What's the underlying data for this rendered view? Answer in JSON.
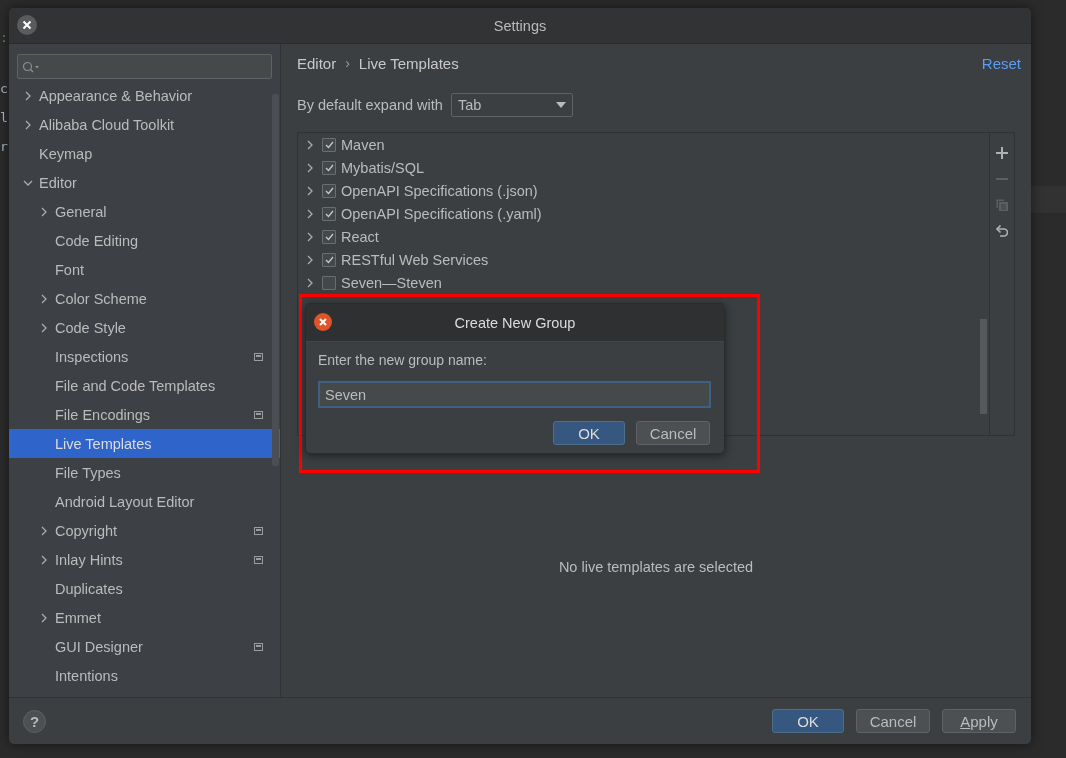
{
  "window": {
    "title": "Settings"
  },
  "background_editor": {
    "fragments": [
      ":",
      "c",
      "l",
      "r"
    ]
  },
  "sidebar": {
    "items": [
      {
        "label": "Appearance & Behavior",
        "expanded": false,
        "selected": false,
        "project_level": false
      },
      {
        "label": "Alibaba Cloud Toolkit",
        "expanded": false,
        "selected": false,
        "project_level": false
      },
      {
        "label": "Keymap",
        "selected": false,
        "project_level": false
      },
      {
        "label": "Editor",
        "expanded": true,
        "selected": false,
        "project_level": false,
        "children": [
          {
            "label": "General",
            "expanded": false,
            "selected": false,
            "project_level": false
          },
          {
            "label": "Code Editing",
            "selected": false,
            "project_level": false
          },
          {
            "label": "Font",
            "selected": false,
            "project_level": false
          },
          {
            "label": "Color Scheme",
            "expanded": false,
            "selected": false,
            "project_level": false
          },
          {
            "label": "Code Style",
            "expanded": false,
            "selected": false,
            "project_level": false
          },
          {
            "label": "Inspections",
            "selected": false,
            "project_level": true
          },
          {
            "label": "File and Code Templates",
            "selected": false,
            "project_level": false
          },
          {
            "label": "File Encodings",
            "selected": false,
            "project_level": true
          },
          {
            "label": "Live Templates",
            "selected": true,
            "project_level": false
          },
          {
            "label": "File Types",
            "selected": false,
            "project_level": false
          },
          {
            "label": "Android Layout Editor",
            "selected": false,
            "project_level": false
          },
          {
            "label": "Copyright",
            "expanded": false,
            "selected": false,
            "project_level": true
          },
          {
            "label": "Inlay Hints",
            "expanded": false,
            "selected": false,
            "project_level": true
          },
          {
            "label": "Duplicates",
            "selected": false,
            "project_level": false
          },
          {
            "label": "Emmet",
            "expanded": false,
            "selected": false,
            "project_level": false
          },
          {
            "label": "GUI Designer",
            "selected": false,
            "project_level": true
          },
          {
            "label": "Intentions",
            "selected": false,
            "project_level": false
          }
        ]
      }
    ]
  },
  "breadcrumb": {
    "items": [
      "Editor",
      "Live Templates"
    ],
    "separator": "›"
  },
  "reset_link": "Reset",
  "expand_setting": {
    "label": "By default expand with",
    "value": "Tab"
  },
  "template_groups": [
    {
      "label": "Maven",
      "expanded": false,
      "checked": true
    },
    {
      "label": "Mybatis/SQL",
      "expanded": false,
      "checked": true
    },
    {
      "label": "OpenAPI Specifications (.json)",
      "expanded": false,
      "checked": true
    },
    {
      "label": "OpenAPI Specifications (.yaml)",
      "expanded": false,
      "checked": true
    },
    {
      "label": "React",
      "expanded": false,
      "checked": true
    },
    {
      "label": "RESTful Web Services",
      "expanded": false,
      "checked": true
    },
    {
      "label": "Seven—Steven",
      "expanded": false,
      "checked": false
    }
  ],
  "list_toolbar": [
    {
      "kind": "add",
      "disabled": false
    },
    {
      "kind": "remove",
      "disabled": true
    },
    {
      "kind": "copy",
      "disabled": true
    },
    {
      "kind": "restore",
      "disabled": false
    }
  ],
  "empty_message": "No live templates are selected",
  "footer": {
    "help": "?",
    "buttons": [
      {
        "label": "OK",
        "primary": true
      },
      {
        "label": "Cancel",
        "primary": false
      },
      {
        "label": "Apply",
        "primary": false
      }
    ]
  },
  "annotation_frame": {
    "kind": "rectangle"
  },
  "dialog": {
    "title": "Create New Group",
    "prompt": "Enter the new group name:",
    "value": "Seven",
    "buttons": [
      {
        "label": "OK",
        "primary": true
      },
      {
        "label": "Cancel",
        "primary": false
      }
    ]
  }
}
